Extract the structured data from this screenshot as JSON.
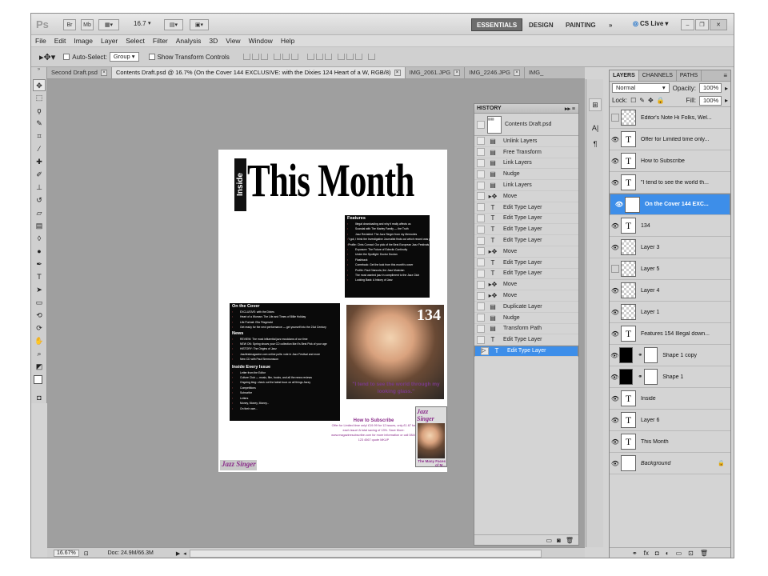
{
  "app": {
    "logo": "Ps"
  },
  "titlebar": {
    "zoom": "16.7",
    "workspaces": [
      "ESSENTIALS",
      "DESIGN",
      "PAINTING",
      "»"
    ],
    "cslive": "CS Live"
  },
  "menu": [
    "File",
    "Edit",
    "Image",
    "Layer",
    "Select",
    "Filter",
    "Analysis",
    "3D",
    "View",
    "Window",
    "Help"
  ],
  "options": {
    "auto_select_label": "Auto-Select:",
    "auto_select_value": "Group",
    "show_transform_label": "Show Transform Controls"
  },
  "tabs": [
    {
      "label": "Second Draft.psd",
      "active": false
    },
    {
      "label": "Contents Draft.psd @ 16.7% (On the Cover 144 EXCLUSIVE: with the Dixies 124 Heart of a W, RGB/8)",
      "active": true
    },
    {
      "label": "IMG_2061.JPG",
      "active": false
    },
    {
      "label": "IMG_2246.JPG",
      "active": false
    },
    {
      "label": "IMG_",
      "active": false
    }
  ],
  "document": {
    "inside": "Inside",
    "headline": "This Month",
    "features_title": "Features",
    "features_lines": [
      "Illegal downloading and why it really affects us",
      "Scandal with The Marley Family — the Truth",
      "Jazz Revisited: The Jazz Singer from my Memories",
      "'I got, I think the Investigative Journalist finds out which record was played on an Apple'",
      "Profile: Chris Conrad: Our pick of the Best European Jazz Festivals",
      "Exposure: The Future of Eclectic Continuity",
      "Under the Spotlight: Doctor Doolan",
      "Flashback",
      "Comeback: Get the look from this month's cover",
      "Profile: Paul Giancola, the Jazz Musician",
      "The most wanted jazz in compliment to the Jazz Club",
      "Looking Back: A history of Jazz"
    ],
    "cover_title": "On the Cover",
    "cover_lines": [
      "EXCLUSIVE: with the Dixies",
      "Heart of a Woman: The Life and Times of Billie Holiday",
      "Life Portrait: Ella Fitzgerald",
      "Get ready for the next performance — get yourself into the 21st Century"
    ],
    "news_title": "News",
    "news_lines": [
      "REVIEW: The most influential jazz musicians of our time",
      "NEW ON: Spring shows your CD collection like it's Best Pick of your age",
      "HISTORY: The Origins of Jazz",
      "Jazzfestmagazine.com online polls: vote in Jazz Festival and more",
      "New CD with Paul Simmonsson"
    ],
    "inside_every_title": "Inside Every Issue",
    "inside_every_lines": [
      "Letter from the Editor",
      "Culture Club — music, film, books, and all the news reviews",
      "Ongoing blog: check out the latest buzz on all things Jazzy",
      "Competitions",
      "Subscribe",
      "Letters",
      "Money, Money, Money...",
      "On their own..."
    ],
    "cover_number": "134",
    "quote": "\"I tend to see the world through my looking glass.\"",
    "subscribe_title": "How to Subscribe",
    "subscribe_body": "Offer for Limited time only! £19.99 for 12 issues, only £1.67 for each issue! A total saving of 13%. Save More: www.magazinesubscribe.com for more information or call 0844 123 4567 quote MKUP",
    "mini_cover_title": "Jazz Singer",
    "mini_cover_caption": "The Many Faces of M...",
    "brand_footer": "Jazz Singer"
  },
  "history": {
    "title": "HISTORY",
    "snapshot": "Contents Draft.psd",
    "items": [
      {
        "label": "Unlink Layers",
        "icon": "doc-icon"
      },
      {
        "label": "Free Transform",
        "icon": "doc-icon"
      },
      {
        "label": "Link Layers",
        "icon": "doc-icon"
      },
      {
        "label": "Nudge",
        "icon": "doc-icon"
      },
      {
        "label": "Link Layers",
        "icon": "doc-icon"
      },
      {
        "label": "Move",
        "icon": "move-icon"
      },
      {
        "label": "Edit Type Layer",
        "icon": "type-icon"
      },
      {
        "label": "Edit Type Layer",
        "icon": "type-icon"
      },
      {
        "label": "Edit Type Layer",
        "icon": "type-icon"
      },
      {
        "label": "Edit Type Layer",
        "icon": "type-icon"
      },
      {
        "label": "Move",
        "icon": "move-icon"
      },
      {
        "label": "Edit Type Layer",
        "icon": "type-icon"
      },
      {
        "label": "Edit Type Layer",
        "icon": "type-icon"
      },
      {
        "label": "Move",
        "icon": "move-icon"
      },
      {
        "label": "Move",
        "icon": "move-icon"
      },
      {
        "label": "Duplicate Layer",
        "icon": "doc-icon"
      },
      {
        "label": "Nudge",
        "icon": "doc-icon"
      },
      {
        "label": "Transform Path",
        "icon": "doc-icon"
      },
      {
        "label": "Edit Type Layer",
        "icon": "type-icon"
      },
      {
        "label": "Edit Type Layer",
        "icon": "type-icon",
        "selected": true
      }
    ]
  },
  "layers": {
    "tabs": [
      "LAYERS",
      "CHANNELS",
      "PATHS"
    ],
    "blend_mode": "Normal",
    "opacity_label": "Opacity:",
    "opacity": "100%",
    "lock_label": "Lock:",
    "fill_label": "Fill:",
    "fill": "100%",
    "items": [
      {
        "name": "Editor's Note  Hi Folks, Wel...",
        "thumb": "checker",
        "eye": false
      },
      {
        "name": "Offer for Limited time only...",
        "thumb": "T",
        "eye": true
      },
      {
        "name": "How to Subscribe",
        "thumb": "T",
        "eye": true
      },
      {
        "name": "\"I tend to see the world th...",
        "thumb": "T",
        "eye": true
      },
      {
        "name": "On the Cover 144  EXC...",
        "thumb": "T",
        "eye": true,
        "selected": true
      },
      {
        "name": "134",
        "thumb": "T",
        "eye": true
      },
      {
        "name": "Layer 3",
        "thumb": "checker",
        "eye": true
      },
      {
        "name": "Layer 5",
        "thumb": "checker",
        "eye": false
      },
      {
        "name": "Layer 4",
        "thumb": "checker",
        "eye": true
      },
      {
        "name": "Layer 1",
        "thumb": "checker",
        "eye": true
      },
      {
        "name": "Features 154  Illegal down...",
        "thumb": "T",
        "eye": true
      },
      {
        "name": "Shape 1 copy",
        "thumb": "black",
        "eye": true
      },
      {
        "name": "Shape 1",
        "thumb": "black",
        "eye": true
      },
      {
        "name": "Inside",
        "thumb": "T",
        "eye": true
      },
      {
        "name": "Layer 6",
        "thumb": "T",
        "eye": true
      },
      {
        "name": "This Month",
        "thumb": "T",
        "eye": true
      },
      {
        "name": "Background",
        "thumb": "white",
        "eye": true,
        "locked": true
      }
    ]
  },
  "status": {
    "zoom": "16.67%",
    "doc": "Doc: 24.9M/66.3M"
  },
  "colors": {
    "selection": "#3d8ee9",
    "accent_purple": "#8a2c8a"
  }
}
